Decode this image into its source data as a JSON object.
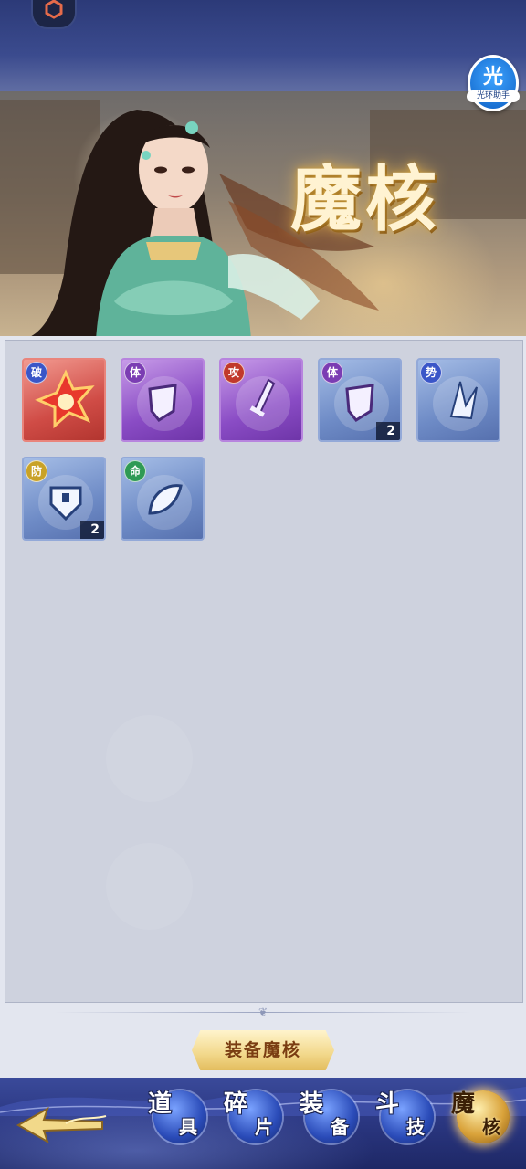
{
  "banner": {
    "title": "魔核",
    "assist": {
      "glyph": "光",
      "label": "光环助手"
    }
  },
  "inventory": {
    "items": [
      {
        "tag": "破",
        "tag_color": "#3a56c8",
        "rarity": "red",
        "shape": "burst",
        "count": ""
      },
      {
        "tag": "体",
        "tag_color": "#7b3db3",
        "rarity": "purple",
        "shape": "shield",
        "count": ""
      },
      {
        "tag": "攻",
        "tag_color": "#c1392b",
        "rarity": "purple",
        "shape": "sword",
        "count": ""
      },
      {
        "tag": "体",
        "tag_color": "#7b3db3",
        "rarity": "blue",
        "shape": "shield",
        "count": "2"
      },
      {
        "tag": "势",
        "tag_color": "#3a56c8",
        "rarity": "blue",
        "shape": "shard",
        "count": ""
      },
      {
        "tag": "防",
        "tag_color": "#c9a227",
        "rarity": "blue",
        "shape": "guard",
        "count": "2"
      },
      {
        "tag": "命",
        "tag_color": "#2f9a55",
        "rarity": "blue",
        "shape": "leaf",
        "count": ""
      }
    ]
  },
  "equip_button": {
    "label": "装备魔核"
  },
  "tabs": [
    {
      "id": "items",
      "char1": "道",
      "char2": "具",
      "active": false
    },
    {
      "id": "fragments",
      "char1": "碎",
      "char2": "片",
      "active": false
    },
    {
      "id": "equipment",
      "char1": "装",
      "char2": "备",
      "active": false
    },
    {
      "id": "skills",
      "char1": "斗",
      "char2": "技",
      "active": false
    },
    {
      "id": "magic-core",
      "char1": "魔",
      "char2": "核",
      "active": true
    }
  ]
}
